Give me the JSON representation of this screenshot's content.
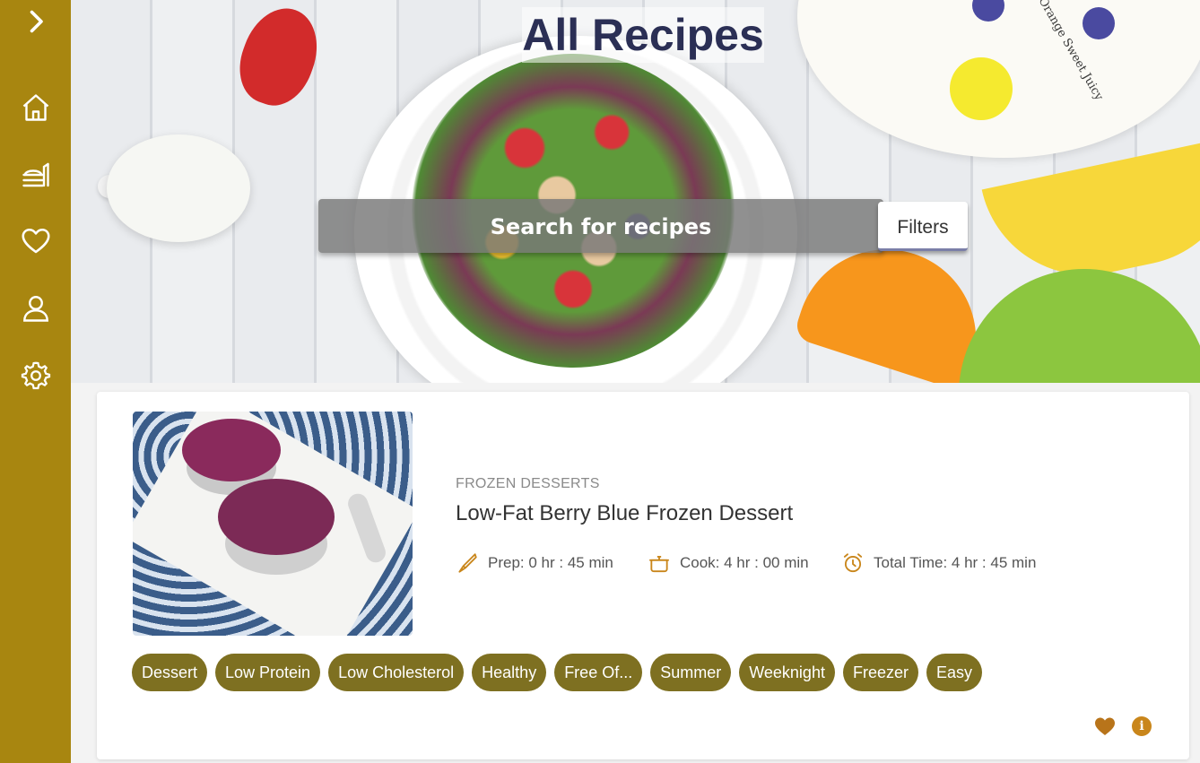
{
  "sidebar": {
    "toggle_icon": "chevron-right-icon",
    "items": [
      {
        "name": "home",
        "icon": "home-icon"
      },
      {
        "name": "recipes",
        "icon": "food-tray-icon"
      },
      {
        "name": "favorites",
        "icon": "heart-icon"
      },
      {
        "name": "profile",
        "icon": "user-icon"
      },
      {
        "name": "settings",
        "icon": "gear-icon"
      }
    ],
    "background": "#a88610"
  },
  "hero": {
    "title": "All Recipes",
    "plate_text": "Hello,Orange Sweet Juicy",
    "search_placeholder": "Search for recipes",
    "filters_label": "Filters"
  },
  "recipe": {
    "category": "FROZEN DESSERTS",
    "title": "Low-Fat Berry Blue Frozen Dessert",
    "prep": "Prep: 0 hr : 45 min",
    "cook": "Cook: 4 hr : 00 min",
    "total": "Total Time: 4 hr : 45 min",
    "tags": [
      "Dessert",
      "Low Protein",
      "Low Cholesterol",
      "Healthy",
      "Free Of...",
      "Summer",
      "Weeknight",
      "Freezer",
      "Easy"
    ],
    "info_label": "i"
  },
  "colors": {
    "accent": "#a88610",
    "tag": "#7e7021",
    "icon": "#c9861b",
    "title": "#2b2f55"
  }
}
